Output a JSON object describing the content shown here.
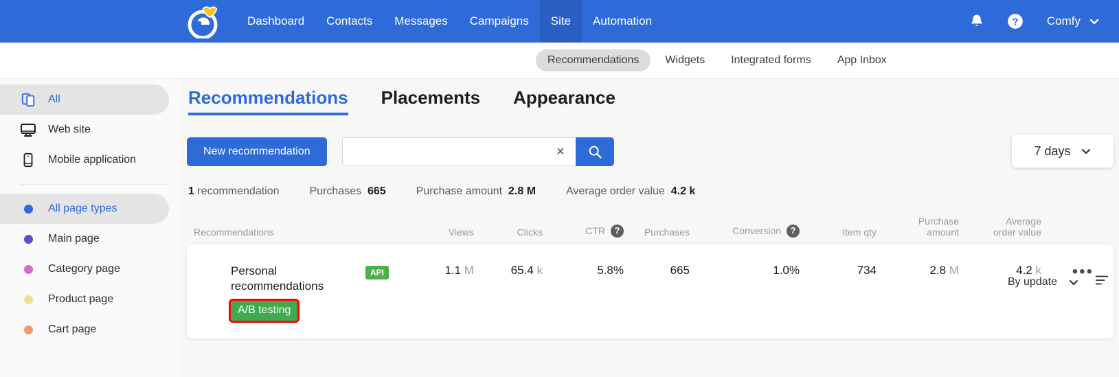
{
  "colors": {
    "brand_blue": "#2f6ad9",
    "nav_active": "#2a60c4",
    "green_badge": "#3faa4e",
    "api_green": "#4caf50",
    "highlight_red": "#ff0000"
  },
  "topnav": {
    "logo_name": "esputnik-logo",
    "links": [
      {
        "label": "Dashboard",
        "active": false
      },
      {
        "label": "Contacts",
        "active": false
      },
      {
        "label": "Messages",
        "active": false
      },
      {
        "label": "Campaigns",
        "active": false
      },
      {
        "label": "Site",
        "active": true
      },
      {
        "label": "Automation",
        "active": false
      }
    ],
    "bell_icon": "bell-icon",
    "help_icon": "help-circle-icon",
    "user_label": "Comfy",
    "user_chevron": "chevron-down-icon"
  },
  "subnav": {
    "items": [
      {
        "label": "Recommendations",
        "active": true
      },
      {
        "label": "Widgets",
        "active": false
      },
      {
        "label": "Integrated forms",
        "active": false
      },
      {
        "label": "App Inbox",
        "active": false
      }
    ]
  },
  "sidebar": {
    "devices": [
      {
        "label": "All",
        "icon": "copy-pages-icon",
        "active": true
      },
      {
        "label": "Web site",
        "icon": "monitor-icon",
        "active": false
      },
      {
        "label": "Mobile application",
        "icon": "mobile-icon",
        "active": false
      }
    ],
    "page_types": [
      {
        "label": "All page types",
        "color": "#2f6ad9",
        "active": true
      },
      {
        "label": "Main page",
        "color": "#5b4fcf",
        "active": false
      },
      {
        "label": "Category page",
        "color": "#d96ad1",
        "active": false
      },
      {
        "label": "Product page",
        "color": "#efdf8e",
        "active": false
      },
      {
        "label": "Cart page",
        "color": "#ef9a68",
        "active": false
      }
    ]
  },
  "tabs": [
    {
      "label": "Recommendations",
      "active": true
    },
    {
      "label": "Placements",
      "active": false
    },
    {
      "label": "Appearance",
      "active": false
    }
  ],
  "toolbar": {
    "new_recommendation_label": "New recommendation",
    "search_value": "",
    "search_placeholder": "",
    "clear_icon": "close-icon",
    "search_icon": "search-icon",
    "days_label": "7 days",
    "days_chevron": "chevron-down-icon"
  },
  "stats": {
    "count_number": "1",
    "count_label": " recommendation",
    "items": [
      {
        "label": "Purchases",
        "value": "665"
      },
      {
        "label": "Purchase amount",
        "value": "2.8 M"
      },
      {
        "label": "Average order value",
        "value": "4.2 k"
      }
    ]
  },
  "sort": {
    "label": "By update",
    "chevron": "chevron-down-icon",
    "sort_icon": "sort-lines-icon"
  },
  "table": {
    "headers": {
      "name": "Recommendations",
      "views": "Views",
      "clicks": "Clicks",
      "ctr": "CTR",
      "purchases": "Purchases",
      "conversion": "Conversion",
      "item_qty": "Item qty",
      "purchase_amount": "Purchase\namount",
      "average_order_value": "Average\norder value"
    },
    "rows": [
      {
        "name": "Personal recommendations",
        "tag": "A/B testing",
        "api_badge": "API",
        "views": "1.1",
        "views_unit": "M",
        "clicks": "65.4",
        "clicks_unit": "k",
        "ctr": "5.8%",
        "purchases": "665",
        "conversion": "1.0%",
        "item_qty": "734",
        "purchase_amount": "2.8",
        "purchase_amount_unit": "M",
        "average_order_value": "4.2",
        "average_order_value_unit": "k",
        "menu": "•••"
      }
    ]
  }
}
